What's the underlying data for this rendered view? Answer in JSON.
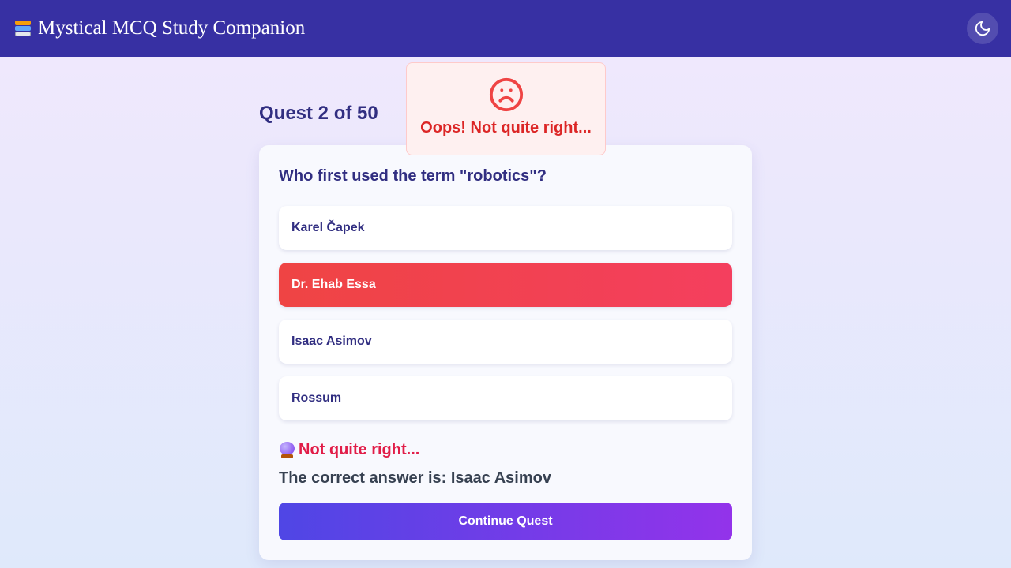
{
  "header": {
    "title": "Mystical MCQ Study Companion",
    "brand_icon": "books-icon",
    "theme_toggle_icon": "moon-icon"
  },
  "quest": {
    "label": "Quest 2 of 50",
    "current": 2,
    "total": 50
  },
  "toast": {
    "icon": "sad-face-icon",
    "message": "Oops! Not quite right..."
  },
  "question": {
    "text": "Who first used the term \"robotics\"?",
    "options": [
      {
        "label": "Karel Čapek",
        "state": "default"
      },
      {
        "label": "Dr. Ehab Essa",
        "state": "selected-wrong"
      },
      {
        "label": "Isaac Asimov",
        "state": "default"
      },
      {
        "label": "Rossum",
        "state": "default"
      }
    ]
  },
  "feedback": {
    "icon": "crystal-ball-icon",
    "status": "Not quite right...",
    "correct_answer": "The correct answer is: Isaac Asimov"
  },
  "actions": {
    "continue_label": "Continue Quest"
  },
  "colors": {
    "header_bg": "#3730a3",
    "wrong": "#ef4444",
    "error_text": "#dc2626",
    "accent_start": "#4f46e5",
    "accent_end": "#9333ea"
  }
}
